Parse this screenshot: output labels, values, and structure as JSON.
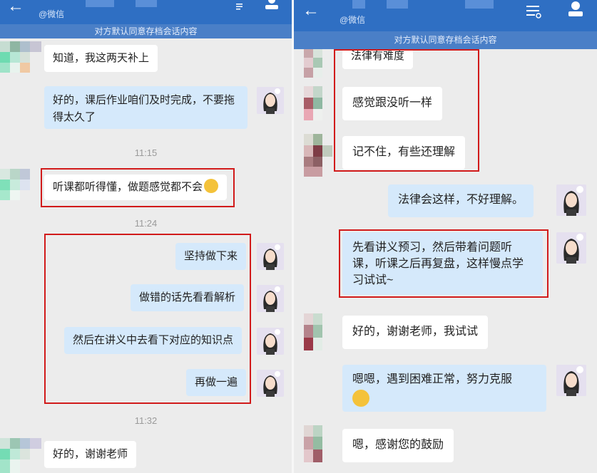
{
  "left": {
    "back_icon": "←",
    "subtitle": "@微信",
    "notice": "对方默认同意存档会话内容",
    "messages": [
      "知道，我这两天补上",
      "好的，课后作业咱们及时完成，不要拖得太久了",
      "11:15",
      "听课都听得懂，做题感觉都不会",
      "11:24",
      "坚持做下来",
      "做错的话先看看解析",
      "然后在讲义中去看下对应的知识点",
      "再做一遍",
      "11:32",
      "好的，谢谢老师"
    ]
  },
  "right": {
    "back_icon": "←",
    "subtitle": "@微信",
    "notice": "对方默认同意存档会话内容",
    "messages": [
      "法律有难度",
      "感觉跟没听一样",
      "记不住，有些还理解",
      "法律会这样，不好理解。",
      "先看讲义预习，然后带着问题听课，听课之后再复盘，这样慢点学习试试~",
      "好的，谢谢老师，我试试",
      "嗯嗯，遇到困难正常，努力克服",
      "嗯，感谢您的鼓励"
    ]
  },
  "icons": {
    "back": "arrow-left-icon",
    "menu": "menu-icon",
    "contact": "contact-icon",
    "emoji": "emoji-icon"
  },
  "colors": {
    "header": "#2f6fc3",
    "notice": "#4a7fc7",
    "incoming_bubble": "#ffffff",
    "outgoing_bubble": "#d5e9fb",
    "highlight": "#d11a1a"
  }
}
